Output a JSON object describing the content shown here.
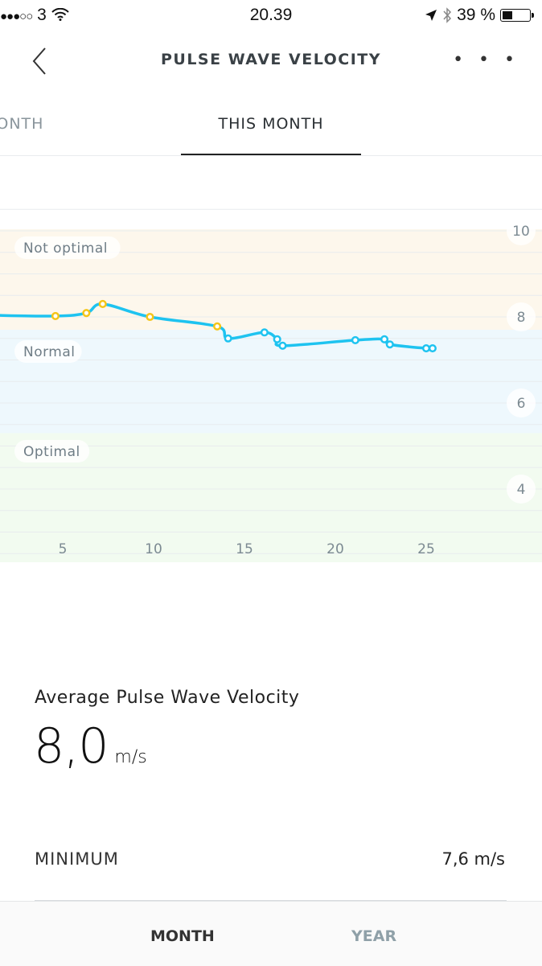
{
  "status_bar": {
    "signal": "●●●○○",
    "carrier": "3",
    "time": "20.39",
    "battery": "39 %",
    "battery_level_percent": 39,
    "icons": [
      "wifi-icon",
      "location-arrow-icon",
      "bluetooth-icon",
      "battery-icon"
    ]
  },
  "header": {
    "title": "PULSE WAVE VELOCITY",
    "back_icon": "chevron-left-icon",
    "more_label": "• • •"
  },
  "tabs": {
    "previous": "MONTH",
    "current": "THIS MONTH"
  },
  "chart_data": {
    "type": "line",
    "x_ticks": [
      "5",
      "10",
      "15",
      "20",
      "25"
    ],
    "y_ticks": [
      "10",
      "8",
      "6",
      "4"
    ],
    "ylim": [
      2.3,
      10
    ],
    "zones": [
      {
        "label": "Not optimal",
        "from": 7.7,
        "to": 10,
        "color": "#fdf7ec"
      },
      {
        "label": "Normal",
        "from": 5.3,
        "to": 7.7,
        "color": "#eef8fd"
      },
      {
        "label": "Optimal",
        "from": 2.3,
        "to": 5.3,
        "color": "#f2fbf0"
      }
    ],
    "line_color": "#1ec3f0",
    "marker_colors": {
      "not_optimal": "#f5c518",
      "normal": "#1ec3f0"
    },
    "grid": true,
    "points": [
      {
        "x": 1.0,
        "y": 8.04
      },
      {
        "x": 4.6,
        "y": 8.02
      },
      {
        "x": 6.3,
        "y": 8.09
      },
      {
        "x": 7.2,
        "y": 8.3
      },
      {
        "x": 9.8,
        "y": 8.0
      },
      {
        "x": 13.5,
        "y": 7.78
      },
      {
        "x": 14.1,
        "y": 7.5
      },
      {
        "x": 16.1,
        "y": 7.64
      },
      {
        "x": 16.8,
        "y": 7.48
      },
      {
        "x": 17.1,
        "y": 7.33
      },
      {
        "x": 21.1,
        "y": 7.46
      },
      {
        "x": 22.7,
        "y": 7.48
      },
      {
        "x": 23.0,
        "y": 7.36
      },
      {
        "x": 25.0,
        "y": 7.27
      },
      {
        "x": 25.35,
        "y": 7.27
      }
    ]
  },
  "summary": {
    "average_label": "Average Pulse Wave Velocity",
    "average_value": "8,0",
    "average_unit": "m/s",
    "minimum_label": "MINIMUM",
    "minimum_value": "7,6 m/s"
  },
  "bottom_tabs": {
    "month": "MONTH",
    "year": "YEAR"
  }
}
